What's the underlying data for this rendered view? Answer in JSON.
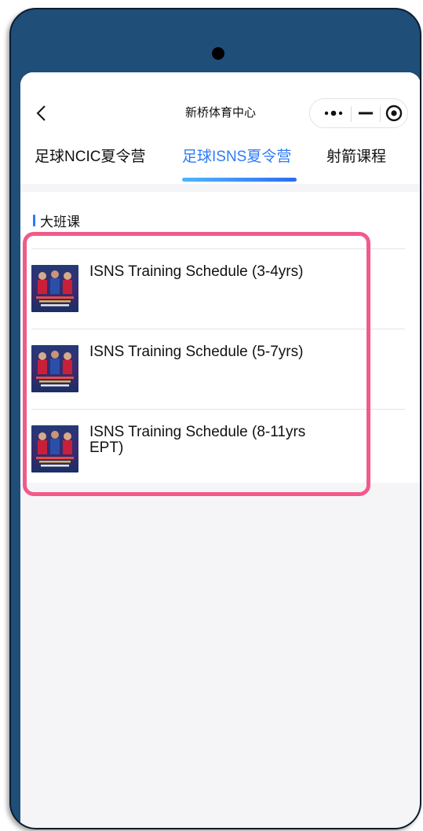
{
  "header": {
    "title": "新桥体育中心",
    "back_icon": "chevron-left-icon",
    "capsule": {
      "more_icon": "more-dots-icon",
      "minimize_icon": "minimize-icon",
      "close_icon": "target-close-icon"
    }
  },
  "tabs": [
    {
      "label": "足球NCIC夏令营",
      "active": false
    },
    {
      "label": "足球ISNS夏令营",
      "active": true
    },
    {
      "label": "射箭课程",
      "active": false
    }
  ],
  "section": {
    "title": "大班课"
  },
  "courses": [
    {
      "title": "ISNS Training Schedule (3-4yrs)",
      "thumb_icon": "football-camp-poster-image"
    },
    {
      "title": "ISNS Training Schedule (5-7yrs)",
      "thumb_icon": "football-camp-poster-image"
    },
    {
      "title": "ISNS Training Schedule (8-11yrs EPT)",
      "thumb_icon": "football-camp-poster-image"
    }
  ],
  "colors": {
    "frame": "#1f4e79",
    "accent": "#2d7bf6",
    "highlight": "#f25a8a"
  }
}
